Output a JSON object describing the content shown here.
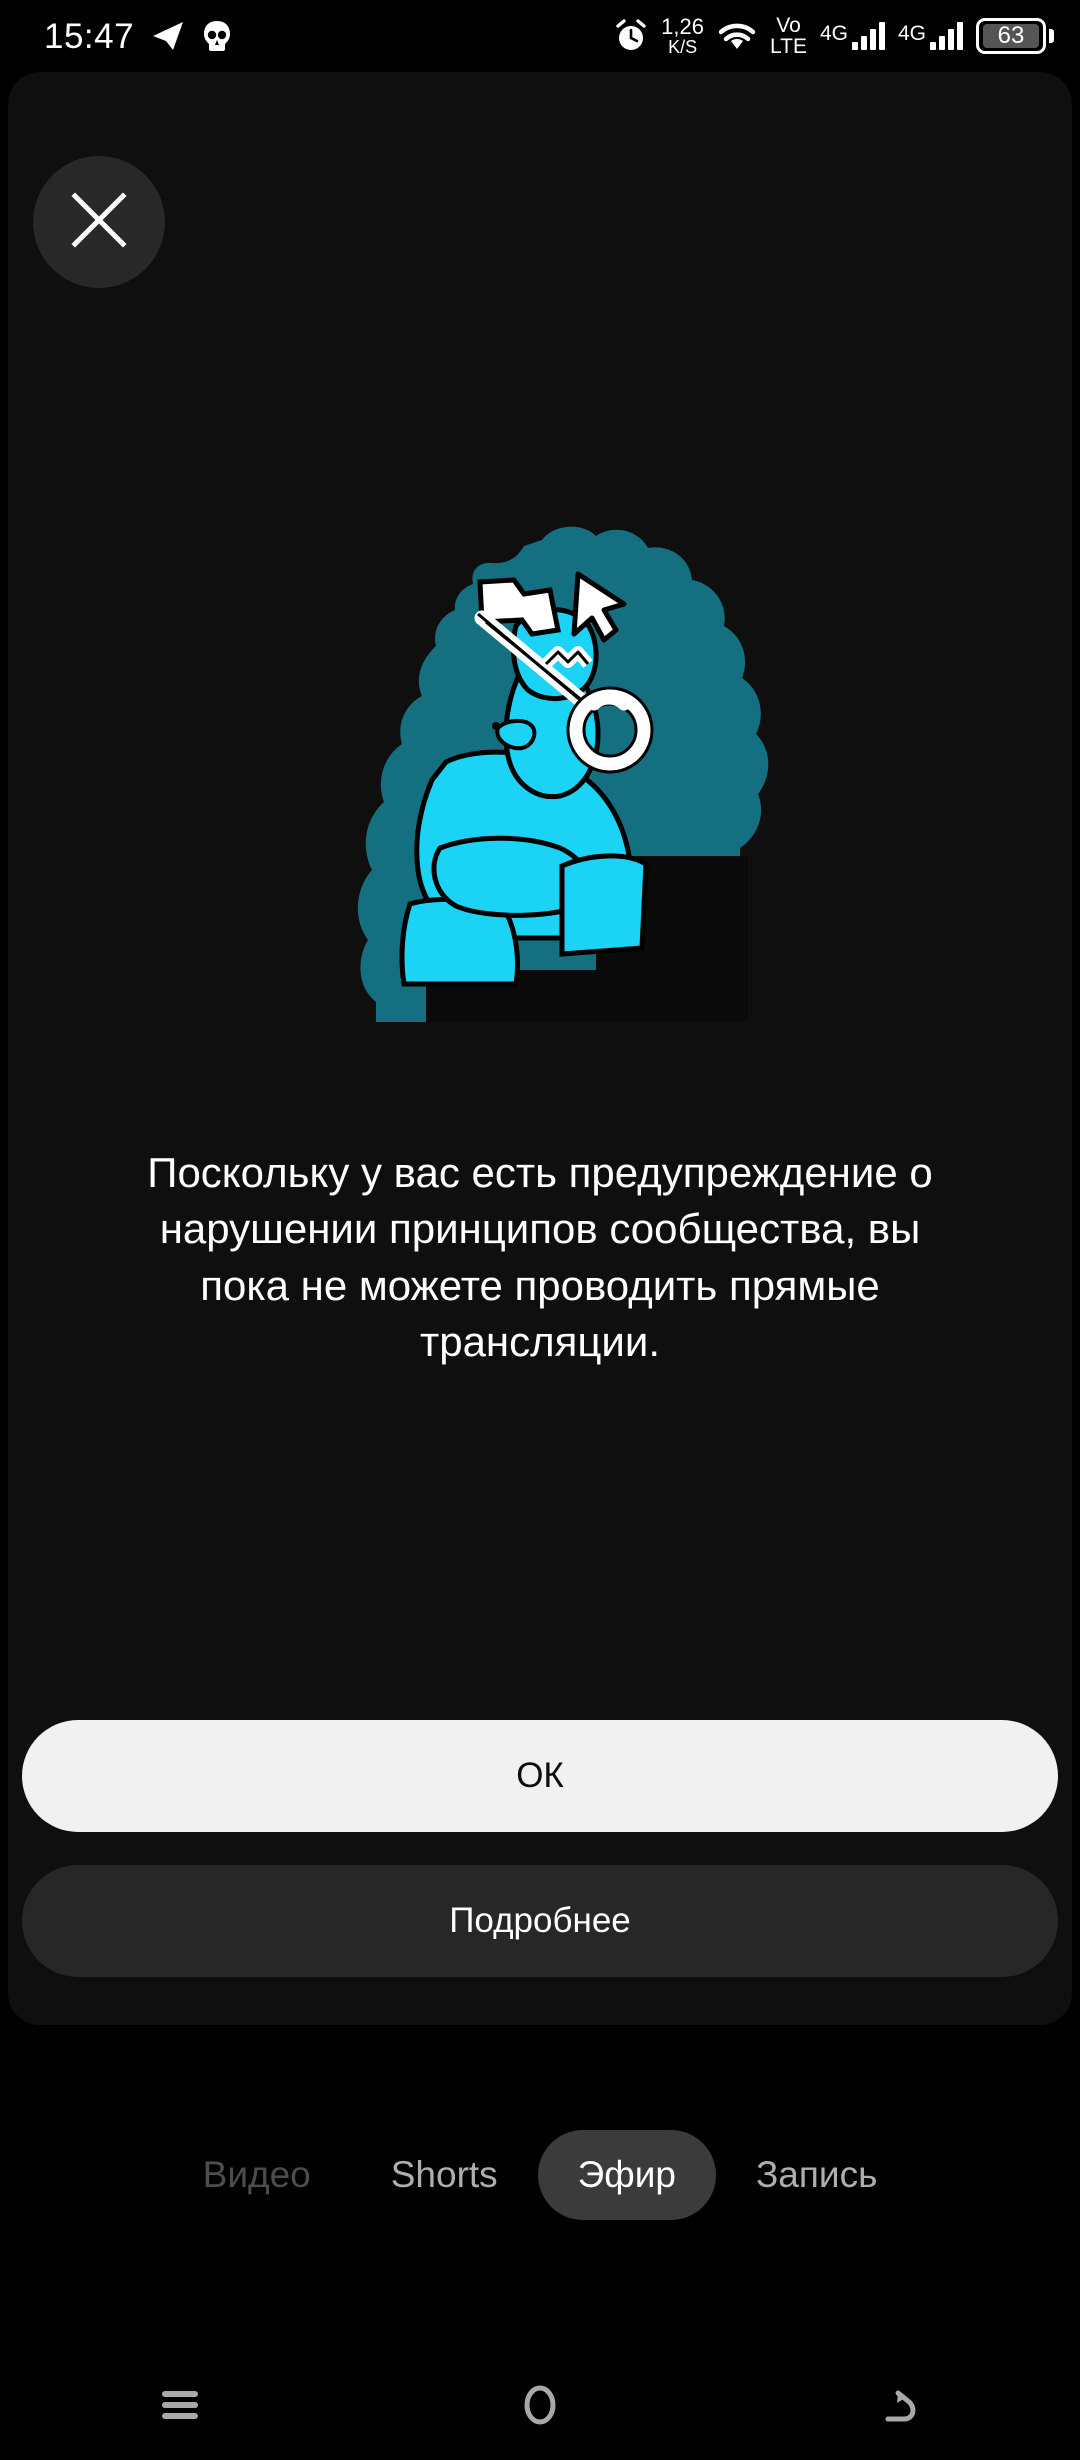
{
  "status_bar": {
    "time": "15:47",
    "telegram_icon": "telegram-icon",
    "skull_icon": "skull-app-icon",
    "alarm_icon": "alarm-clock-icon",
    "net_speed_value": "1,26",
    "net_speed_unit": "K/S",
    "wifi_icon": "wifi-icon",
    "volte_top": "Vo",
    "volte_bottom": "LTE",
    "sim1_network": "4G",
    "sim2_network": "4G",
    "battery_percent": "63"
  },
  "dialog": {
    "close_label": "close-icon",
    "illustration_name": "blocked-livestream-illustration",
    "message": "Поскольку у вас есть предупреждение о нарушении принципов сообщества, вы пока не можете проводить прямые трансляции.",
    "primary_button": "ОК",
    "secondary_button": "Подробнее"
  },
  "tabs": [
    {
      "label": "Видео",
      "state": "dim"
    },
    {
      "label": "Shorts",
      "state": "normal"
    },
    {
      "label": "Эфир",
      "state": "active"
    },
    {
      "label": "Запись",
      "state": "normal"
    }
  ],
  "nav_bar": {
    "recents": "menu-icon",
    "home": "home-circle-icon",
    "back": "back-arrow-icon"
  },
  "colors": {
    "page_bg": "#000000",
    "card_bg": "#0f0f0f",
    "accent_cyan": "#1ad3f5",
    "accent_teal": "#147080",
    "primary_btn_bg": "#f1f1f1",
    "secondary_btn_bg": "#272727",
    "active_tab_bg": "#3b3b3b"
  }
}
